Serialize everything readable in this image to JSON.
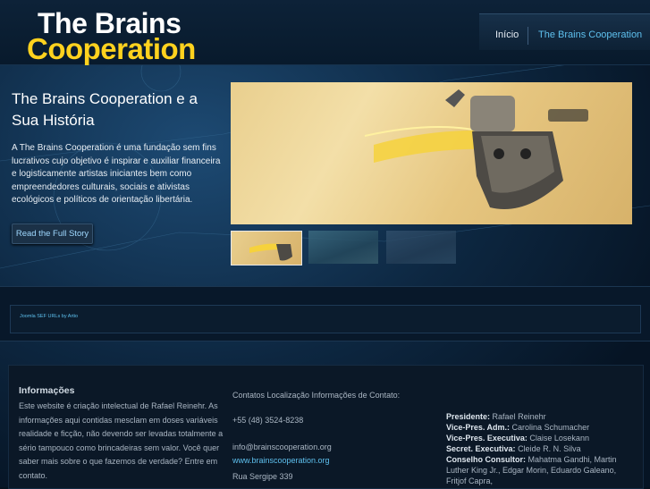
{
  "header": {
    "logo_line1": "The Brains",
    "logo_line2": "Cooperation",
    "nav": [
      {
        "label": "Início"
      },
      {
        "label": "The Brains Cooperation"
      }
    ]
  },
  "hero": {
    "title": "The Brains Cooperation e a Sua História",
    "text": "A The Brains Cooperation é uma fundação sem fins lucrativos cujo objetivo é inspirar e auxiliar financeira e logisticamente artistas iniciantes bem como empreendedores culturais, sociais e ativistas ecológicos e políticos de orientação libertária.",
    "button": "Read the Full Story"
  },
  "strip": {
    "link": "Joomla SEF URLs by Artio"
  },
  "footer": {
    "info_title": "Informações",
    "info_text": "Este website é criação intelectual de Rafael Reinehr. As informações aqui contidas mesclam em doses variáveis realidade e ficção, não devendo ser levadas totalmente a sério tampouco como brincadeiras sem valor. Você quer saber mais sobre o que fazemos de verdade? Entre em contato.",
    "contact_heading": "Contatos Localização Informações de Contato:",
    "phone": "+55 (48) 3524-8238",
    "email": "info@brainscooperation.org",
    "website": "www.brainscooperation.org",
    "address": "Rua Sergipe 339",
    "roles": [
      {
        "label": "Presidente:",
        "value": "Rafael Reinehr"
      },
      {
        "label": "Vice-Pres. Adm.:",
        "value": "Carolina Schumacher"
      },
      {
        "label": "Vice-Pres. Executiva:",
        "value": "Claise Losekann"
      },
      {
        "label": "Secret. Executiva:",
        "value": "Cleide R. N. Silva"
      },
      {
        "label": "Conselho Consultor:",
        "value": "Mahatma Gandhi, Martin Luther King Jr., Edgar Morin, Eduardo Galeano, Fritjof Capra,"
      }
    ]
  }
}
